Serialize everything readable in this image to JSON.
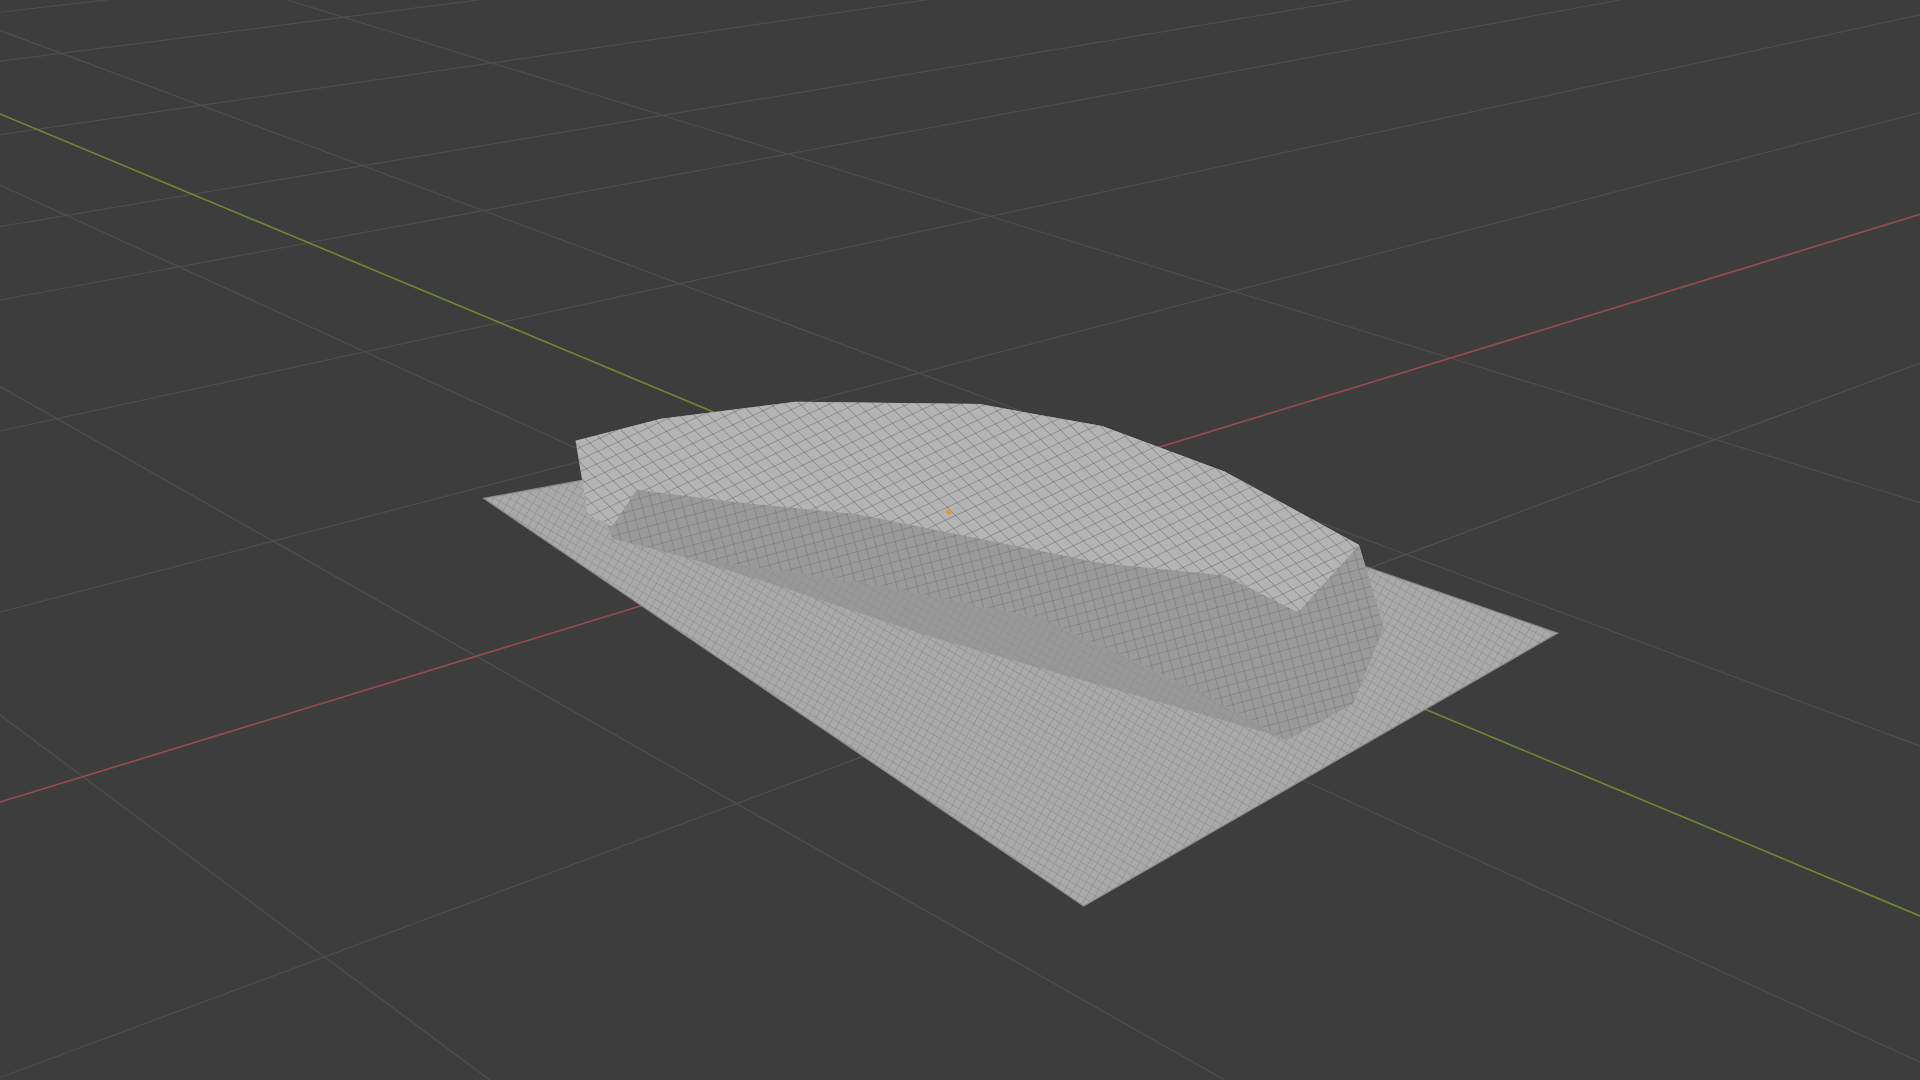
{
  "viewport": {
    "show_floor_grid": true,
    "show_x_axis": true,
    "show_y_axis": true,
    "show_origin": true
  }
}
